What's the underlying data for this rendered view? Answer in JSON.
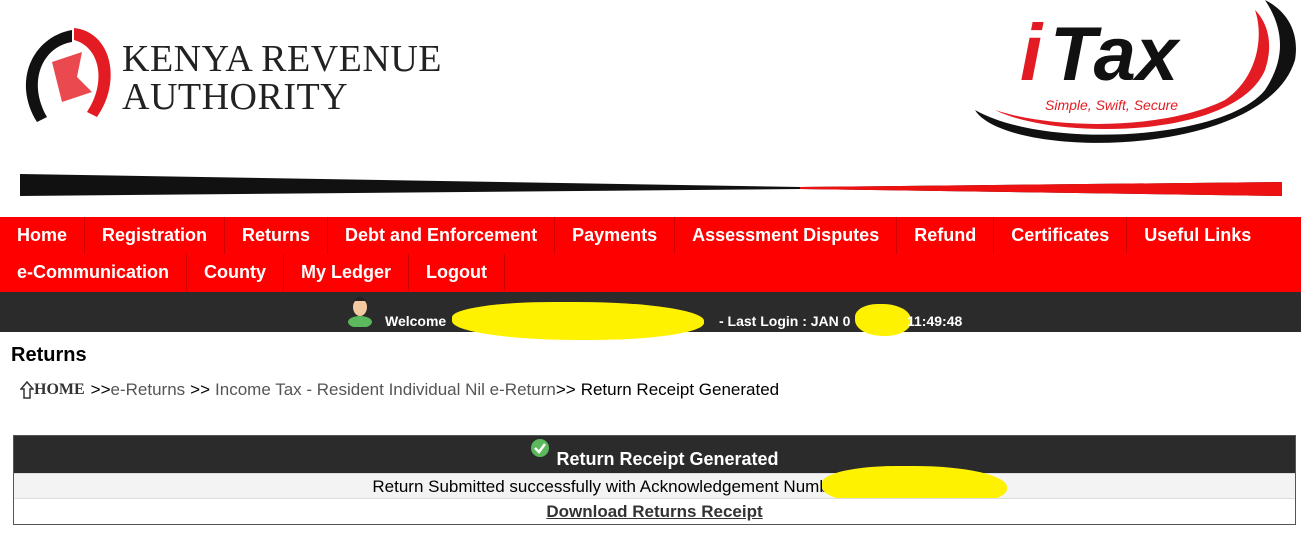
{
  "header": {
    "kra_line1": "KENYA REVENUE",
    "kra_line2": "AUTHORITY",
    "itax_logo": "iTax",
    "itax_tagline": "Simple, Swift, Secure"
  },
  "nav": {
    "row1": [
      "Home",
      "Registration",
      "Returns",
      "Debt and Enforcement",
      "Payments",
      "Assessment Disputes",
      "Refund",
      "Certificates",
      "Useful Links"
    ],
    "row2": [
      "e-Communication",
      "County",
      "My Ledger",
      "Logout"
    ]
  },
  "welcome": {
    "welcome_label": "Welcome",
    "last_login_label": "- Last Login : JAN 0",
    "last_login_time": "11:49:48",
    "user_icon": "user-avatar-icon"
  },
  "page": {
    "title": "Returns"
  },
  "breadcrumb": {
    "home": "HOME",
    "sep1": ">>",
    "item1": "e-Returns",
    "sep2": ">>",
    "item2": "Income Tax - Resident Individual Nil e-Return",
    "sep3": ">>",
    "current": "Return Receipt Generated"
  },
  "receipt": {
    "title": "Return Receipt Generated",
    "message": "Return Submitted successfully with Acknowledgement Number:",
    "download_link": "Download Returns Receipt"
  },
  "colors": {
    "brand_red": "#ff0000",
    "dark_bar": "#2b2b2b",
    "redaction": "#fff200"
  }
}
